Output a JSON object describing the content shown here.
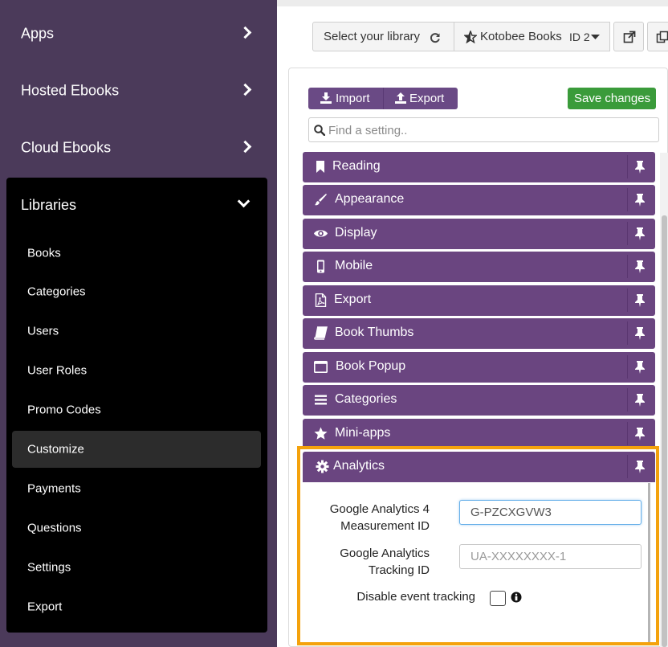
{
  "sidebar": {
    "top_items": [
      {
        "label": "Apps"
      },
      {
        "label": "Hosted Ebooks"
      },
      {
        "label": "Cloud Ebooks"
      }
    ],
    "libraries": {
      "label": "Libraries",
      "items": [
        {
          "label": "Books"
        },
        {
          "label": "Categories"
        },
        {
          "label": "Users"
        },
        {
          "label": "User Roles"
        },
        {
          "label": "Promo Codes"
        },
        {
          "label": "Customize",
          "active": true
        },
        {
          "label": "Payments"
        },
        {
          "label": "Questions"
        },
        {
          "label": "Settings"
        },
        {
          "label": "Export"
        }
      ]
    }
  },
  "topbar": {
    "select_library": "Select your library",
    "library_name": "Kotobee Books",
    "library_id": "ID 2"
  },
  "toolbar": {
    "import_label": "Import",
    "export_label": "Export",
    "save_label": "Save changes"
  },
  "search": {
    "placeholder": "Find a setting.."
  },
  "panels": [
    {
      "label": "Reading",
      "icon": "bookmark-icon"
    },
    {
      "label": "Appearance",
      "icon": "paintbrush-icon"
    },
    {
      "label": "Display",
      "icon": "eye-icon"
    },
    {
      "label": "Mobile",
      "icon": "mobile-icon"
    },
    {
      "label": "Export",
      "icon": "pdf-file-icon"
    },
    {
      "label": "Book Thumbs",
      "icon": "book-icon"
    },
    {
      "label": "Book Popup",
      "icon": "window-icon"
    },
    {
      "label": "Categories",
      "icon": "list-icon"
    },
    {
      "label": "Mini-apps",
      "icon": "star-icon"
    },
    {
      "label": "Analytics",
      "icon": "gear-icon",
      "expanded": true
    }
  ],
  "analytics": {
    "ga4_label_line1": "Google Analytics 4",
    "ga4_label_line2": "Measurement ID",
    "ga4_value": "G-PZCXGVW3",
    "ua_label_line1": "Google Analytics",
    "ua_label_line2": "Tracking ID",
    "ua_placeholder": "UA-XXXXXXXX-1",
    "disable_tracking_label": "Disable event tracking"
  },
  "colors": {
    "sidebar_bg": "#4b3a5a",
    "panel_purple": "#6a4580",
    "save_green": "#3a9b3a",
    "highlight_orange": "#f4a20c"
  }
}
